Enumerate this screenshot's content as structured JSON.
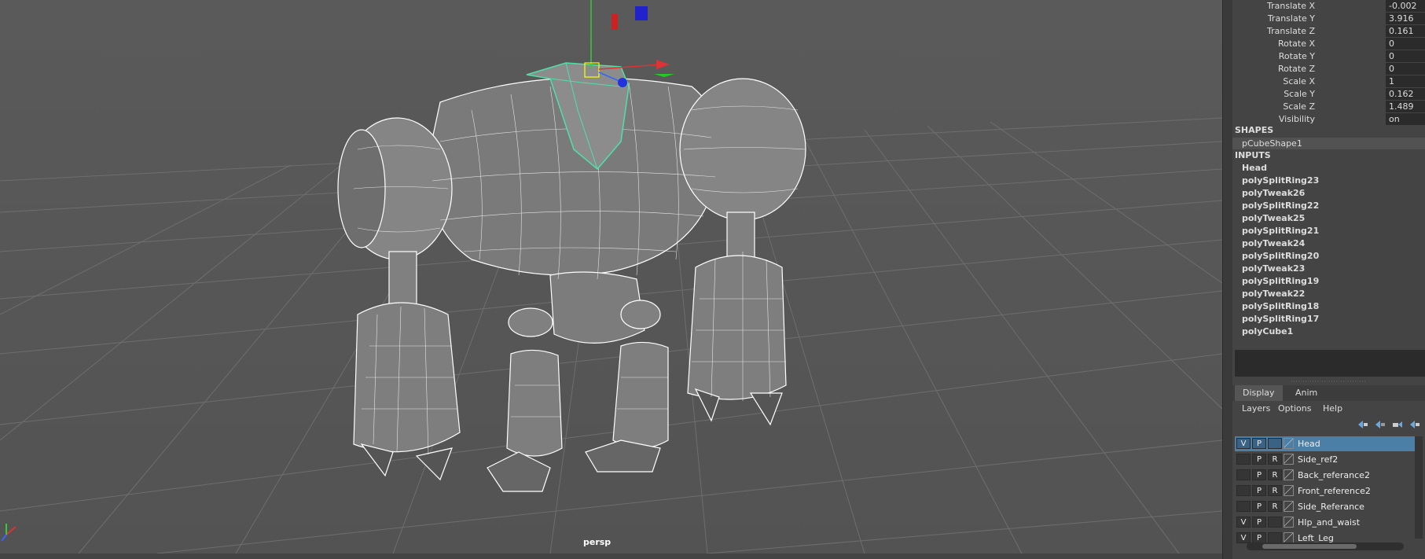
{
  "viewport": {
    "camera_label": "persp"
  },
  "channel_box": {
    "attributes": [
      {
        "label": "Translate X",
        "value": "-0.002"
      },
      {
        "label": "Translate Y",
        "value": "3.916"
      },
      {
        "label": "Translate Z",
        "value": "0.161"
      },
      {
        "label": "Rotate X",
        "value": "0"
      },
      {
        "label": "Rotate Y",
        "value": "0"
      },
      {
        "label": "Rotate Z",
        "value": "0"
      },
      {
        "label": "Scale X",
        "value": "1"
      },
      {
        "label": "Scale Y",
        "value": "0.162"
      },
      {
        "label": "Scale Z",
        "value": "1.489"
      },
      {
        "label": "Visibility",
        "value": "on"
      }
    ],
    "shapes_header": "SHAPES",
    "shape_name": "pCubeShape1",
    "inputs_header": "INPUTS",
    "inputs": [
      "Head",
      "polySplitRing23",
      "polyTweak26",
      "polySplitRing22",
      "polyTweak25",
      "polySplitRing21",
      "polyTweak24",
      "polySplitRing20",
      "polyTweak23",
      "polySplitRing19",
      "polyTweak22",
      "polySplitRing18",
      "polySplitRing17",
      "polyCube1"
    ]
  },
  "layer_editor": {
    "tabs": [
      "Display",
      "Anim"
    ],
    "menus": [
      "Layers",
      "Options",
      "Help"
    ],
    "layers": [
      {
        "v": "V",
        "p": "P",
        "r": "",
        "name": "Head",
        "selected": true
      },
      {
        "v": "",
        "p": "P",
        "r": "R",
        "name": "Side_ref2",
        "selected": false
      },
      {
        "v": "",
        "p": "P",
        "r": "R",
        "name": "Back_referance2",
        "selected": false
      },
      {
        "v": "",
        "p": "P",
        "r": "R",
        "name": "Front_reference2",
        "selected": false
      },
      {
        "v": "",
        "p": "P",
        "r": "R",
        "name": "Side_Referance",
        "selected": false
      },
      {
        "v": "V",
        "p": "P",
        "r": "",
        "name": "HIp_and_waist",
        "selected": false
      },
      {
        "v": "V",
        "p": "P",
        "r": "",
        "name": "Left_Leg",
        "selected": false
      }
    ]
  },
  "colors": {
    "selection": "#4c7fa6",
    "wire": "#ffffff",
    "selected_wire": "#4fe0a8"
  }
}
